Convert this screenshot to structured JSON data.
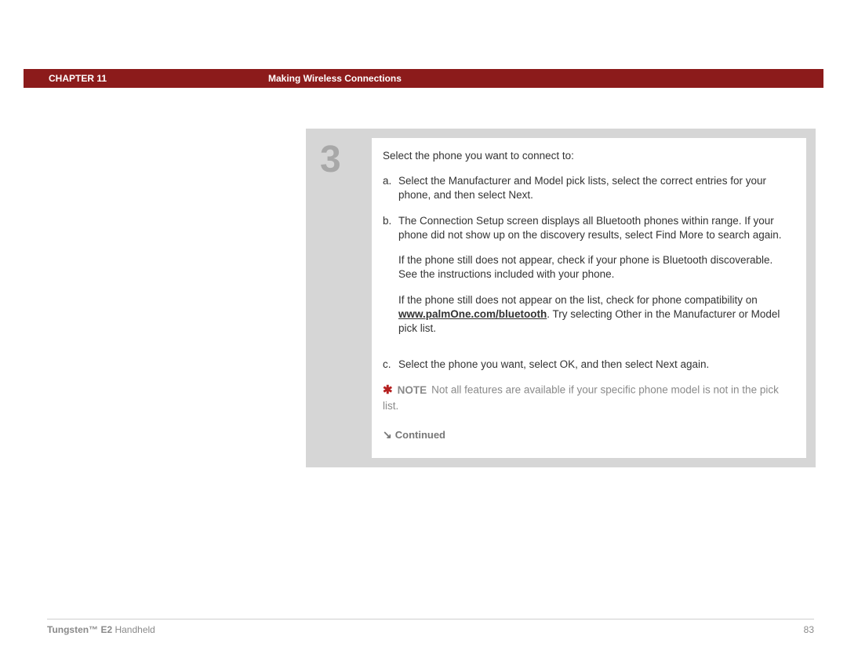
{
  "header": {
    "chapter": "CHAPTER 11",
    "title": "Making Wireless Connections"
  },
  "step": {
    "number": "3",
    "intro": "Select the phone you want to connect to:",
    "items": {
      "a": {
        "letter": "a.",
        "text": "Select the Manufacturer and Model pick lists, select the correct entries for your phone, and then select Next."
      },
      "b": {
        "letter": "b.",
        "p1": "The Connection Setup screen displays all Bluetooth phones within range. If your phone did not show up on the discovery results, select Find More to search again.",
        "p2": "If the phone still does not appear, check if your phone is Bluetooth discoverable. See the instructions included with your phone.",
        "p3_prefix": "If the phone still does not appear on the list, check for phone compatibility on ",
        "p3_link": "www.palmOne.com/bluetooth",
        "p3_suffix": ". Try selecting Other in the Manufacturer or Model pick list."
      },
      "c": {
        "letter": "c.",
        "text": "Select the phone you want, select OK, and then select Next again."
      }
    },
    "note": {
      "label": "NOTE",
      "text": "Not all features are available if your specific phone model is not in the pick list."
    },
    "continued": "Continued"
  },
  "footer": {
    "product_bold": "Tungsten™ E2",
    "product_rest": " Handheld",
    "page": "83"
  }
}
